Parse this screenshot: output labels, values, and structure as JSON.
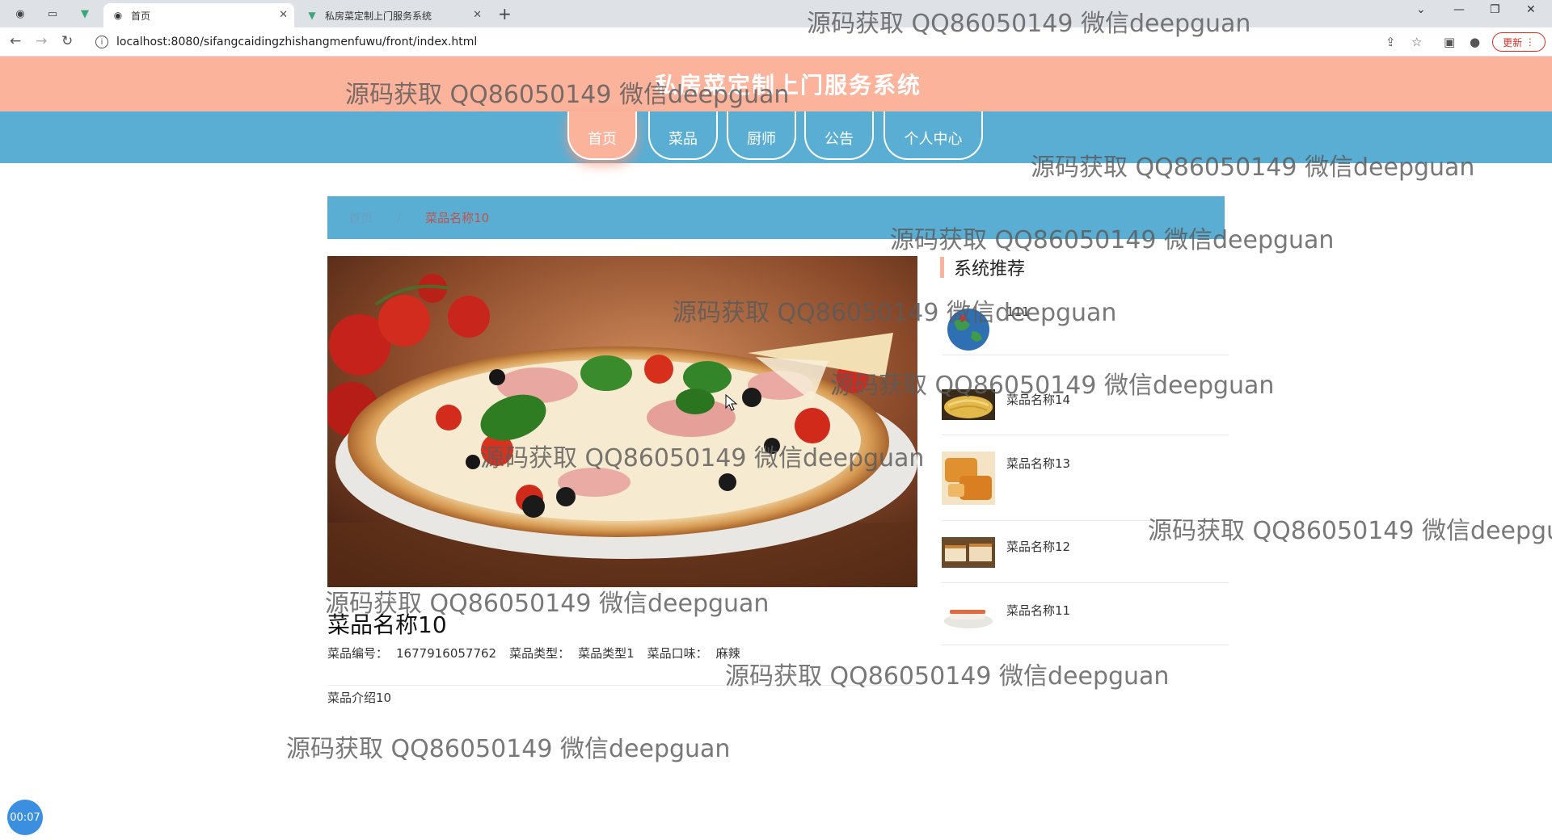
{
  "browser": {
    "tabs": [
      {
        "title": "首页",
        "active": true
      },
      {
        "title": "私房菜定制上门服务系统",
        "active": false
      }
    ],
    "url": "localhost:8080/sifangcaidingzhishangmenfuwu/front/index.html",
    "update_label": "更新"
  },
  "site": {
    "title": "私房菜定制上门服务系统",
    "nav": [
      "首页",
      "菜品",
      "厨师",
      "公告",
      "个人中心"
    ],
    "active_nav": "首页"
  },
  "breadcrumb": {
    "home": "首页",
    "separator": "/",
    "current": "菜品名称10"
  },
  "product": {
    "name": "菜品名称10",
    "number_label": "菜品编号：",
    "number": "1677916057762",
    "type_label": "菜品类型：",
    "type": "菜品类型1",
    "taste_label": "菜品口味：",
    "taste": "麻辣",
    "intro": "菜品介绍10"
  },
  "recommend": {
    "title": "系统推荐",
    "items": [
      {
        "name": "111",
        "thumb": "globe-image"
      },
      {
        "name": "菜品名称14",
        "thumb": "noodles-image"
      },
      {
        "name": "菜品名称13",
        "thumb": "bread-image"
      },
      {
        "name": "菜品名称12",
        "thumb": "cake-image"
      },
      {
        "name": "菜品名称11",
        "thumb": "sushi-image"
      }
    ]
  },
  "timer": "00:07",
  "watermark": "源码获取 QQ86050149 微信deepguan",
  "colors": {
    "header": "#fbb39b",
    "nav": "#5aaed4",
    "accent": "#fbb39b"
  }
}
